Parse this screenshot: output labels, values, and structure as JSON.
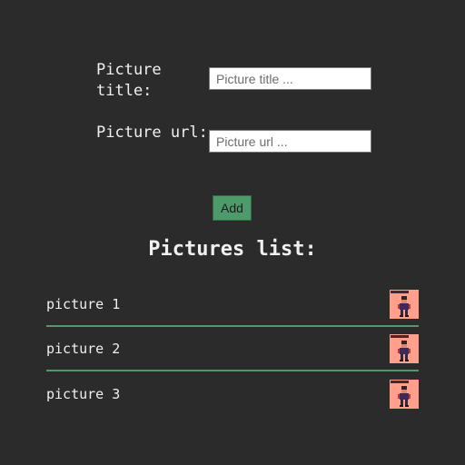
{
  "form": {
    "title_label": "Picture title:",
    "title_placeholder": "Picture title ...",
    "url_label": "Picture url:",
    "url_placeholder": "Picture url ...",
    "add_label": "Add"
  },
  "list": {
    "heading": "Pictures list:",
    "items": [
      {
        "name": "picture 1",
        "thumb_icon": "pixel-character-icon",
        "thumb_bg": "#ff9f8c"
      },
      {
        "name": "picture 2",
        "thumb_icon": "pixel-character-icon",
        "thumb_bg": "#ff9f8c"
      },
      {
        "name": "picture 3",
        "thumb_icon": "pixel-character-icon",
        "thumb_bg": "#ff9f8c"
      }
    ]
  },
  "colors": {
    "background": "#2b2b2b",
    "accent": "#4e9a6a",
    "text": "#f0f0f0"
  }
}
